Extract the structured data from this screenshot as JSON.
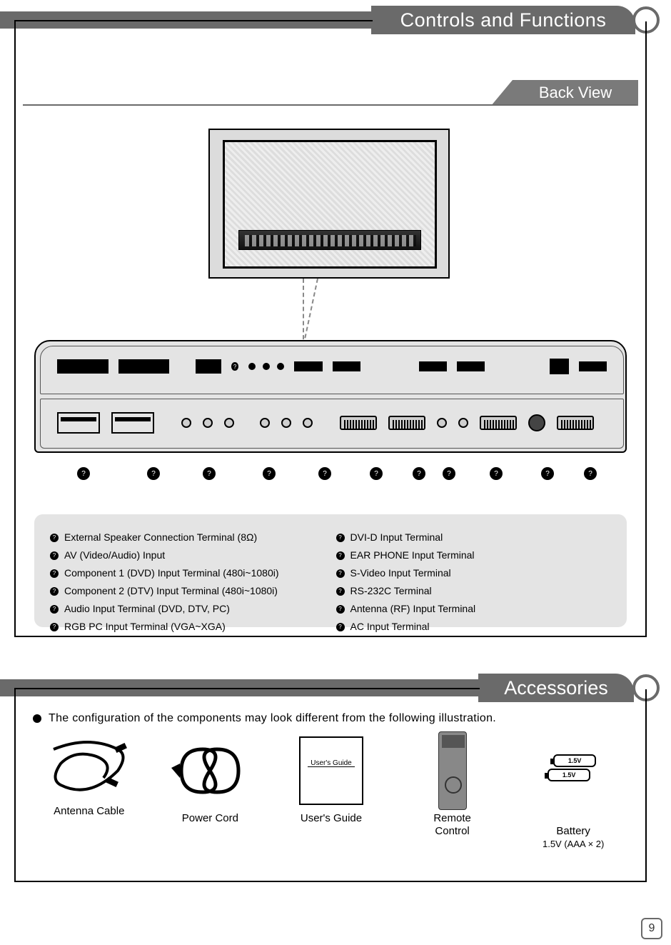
{
  "page_number": "9",
  "section1": {
    "title": "Controls and Functions",
    "subtitle": "Back View",
    "descriptions_left": [
      "External Speaker Connection Terminal (8Ω)",
      "AV (Video/Audio) Input",
      "Component 1 (DVD) Input Terminal (480i~1080i)",
      "Component 2 (DTV) Input Terminal (480i~1080i)",
      "Audio Input Terminal (DVD, DTV, PC)",
      "RGB PC Input Terminal (VGA~XGA)"
    ],
    "descriptions_right": [
      "DVI-D Input Terminal",
      "EAR PHONE Input Terminal",
      "S-Video Input Terminal",
      "RS-232C Terminal",
      "Antenna (RF) Input Terminal",
      "AC Input Terminal"
    ]
  },
  "section2": {
    "title": "Accessories",
    "note": "The configuration of the components may look different from the following illustration.",
    "items": {
      "antenna": "Antenna Cable",
      "cord": "Power Cord",
      "guide": "User's Guide",
      "guide_caption": "User's Guide",
      "remote": "Remote\nControl",
      "battery": "Battery",
      "battery_spec": "1.5V (AAA × 2)",
      "battery_cell": "1.5V"
    }
  }
}
